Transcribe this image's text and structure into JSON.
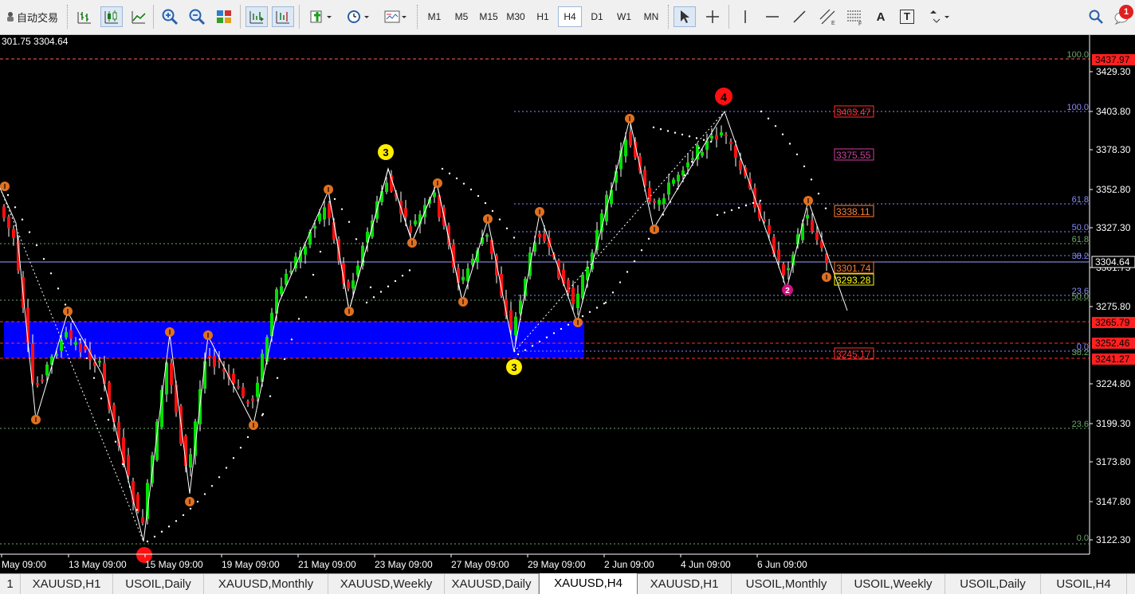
{
  "toolbar": {
    "autotrade_label": "自动交易",
    "timeframes": [
      "M1",
      "M5",
      "M15",
      "M30",
      "H1",
      "H4",
      "D1",
      "W1",
      "MN"
    ],
    "active_timeframe": "H4",
    "notification_count": "1",
    "text_tool_label": "A",
    "label_tool_label": "T"
  },
  "chart": {
    "ohlc_info": "301.75 3304.64",
    "price_axis": [
      "3429.30",
      "3403.80",
      "3378.30",
      "3352.80",
      "3327.30",
      "3301.75",
      "3275.80",
      "3224.80",
      "3199.30",
      "3173.80",
      "3147.80",
      "3122.30"
    ],
    "time_axis": [
      "May 09:00",
      "13 May 09:00",
      "15 May 09:00",
      "19 May 09:00",
      "21 May 09:00",
      "23 May 09:00",
      "27 May 09:00",
      "29 May 09:00",
      "2 Jun 09:00",
      "4 Jun 09:00",
      "6 Jun 09:00"
    ],
    "axis_tags": {
      "t3437": "3437.97",
      "t3304": "3304.64",
      "t3265": "3265.79",
      "t3252": "3252.46",
      "t3241": "3241.27"
    },
    "level_labels": {
      "l3403": "3403.47",
      "l3375": "3375.55",
      "l3338": "3338.11",
      "l3301": "3301.74",
      "l3293": "3293.28",
      "l3245": "3245.17"
    },
    "fib_labels": {
      "f100a": "100.0",
      "f100b": "100.0",
      "f618a": "61.8",
      "f500a": "50.0",
      "f618b": "61.8",
      "f382a": "38.2",
      "f236a": "23.6",
      "f500b": "50.0",
      "f0a": "0.0",
      "f382b": "38.2",
      "f236b": "23.6",
      "f0b": "0.0"
    },
    "wave_labels": {
      "w3a": "3",
      "w3b": "3",
      "w4": "4",
      "w2": "2"
    },
    "colors": {
      "bull": "#00e000",
      "bear": "#ff1010",
      "zone": "#0000ff",
      "fib": "#8a8aff",
      "tag_red": "#ff2020",
      "tag_yellow": "#ffff00"
    }
  },
  "tabs": [
    "1",
    "XAUUSD,H1",
    "USOIL,Daily",
    "XAUUSD,Monthly",
    "XAUUSD,Weekly",
    "XAUUSD,Daily",
    "XAUUSD,H4",
    "XAUUSD,H1",
    "USOIL,Monthly",
    "USOIL,Weekly",
    "USOIL,Daily",
    "USOIL,H4"
  ],
  "active_tab": "XAUUSD,H4"
}
